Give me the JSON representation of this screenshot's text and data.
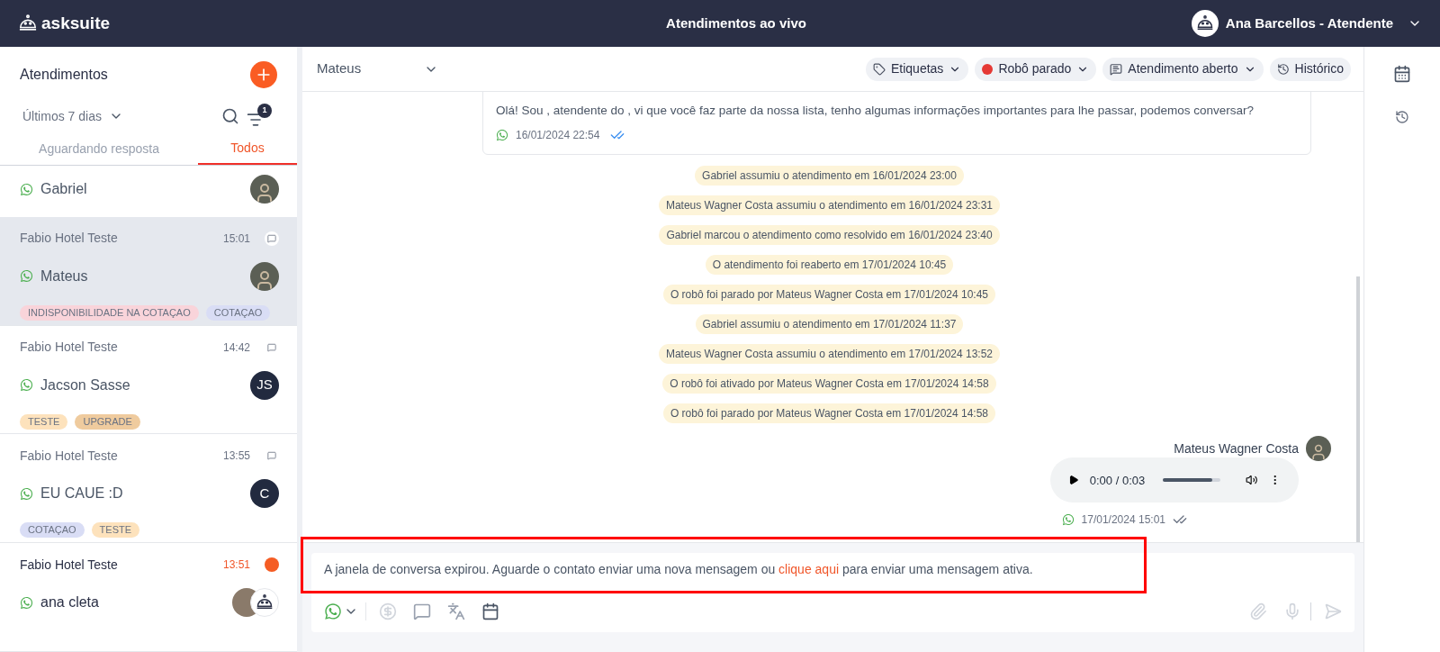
{
  "header": {
    "logo_text": "asksuite",
    "title": "Atendimentos ao vivo",
    "user": "Ana Barcellos - Atendente"
  },
  "sidebar": {
    "title": "Atendimentos",
    "period": "Últimos 7 dias",
    "filter_count": "1",
    "tabs": [
      {
        "label": "Aguardando resposta",
        "selected": false
      },
      {
        "label": "Todos",
        "selected": true
      }
    ],
    "conversations": [
      {
        "name": "Gabriel",
        "kind": "photo",
        "selected": false,
        "unread": false
      },
      {
        "hotel": "Fabio Hotel Teste",
        "time": "15:01",
        "name": "Mateus",
        "kind": "photo",
        "selected": true,
        "unread": false,
        "tags": [
          {
            "label": "INDISPONIBILIDADE NA COTAÇAO",
            "color": "#f9d4da"
          },
          {
            "label": "COTAÇAO",
            "color": "#d9ddf5"
          }
        ]
      },
      {
        "hotel": "Fabio Hotel Teste",
        "time": "14:42",
        "name": "Jacson Sasse",
        "kind": "initials",
        "initials": "JS",
        "selected": false,
        "unread": false,
        "tags": [
          {
            "label": "TESTE",
            "color": "#fde2bc"
          },
          {
            "label": "UPGRADE",
            "color": "#efcb9e"
          }
        ]
      },
      {
        "hotel": "Fabio Hotel Teste",
        "time": "13:55",
        "name": "EU CAUE :D",
        "kind": "initials",
        "initials": "C",
        "selected": false,
        "unread": false,
        "tags": [
          {
            "label": "COTAÇAO",
            "color": "#d9ddf5"
          },
          {
            "label": "TESTE",
            "color": "#fde2bc"
          }
        ]
      },
      {
        "hotel": "Fabio Hotel Teste",
        "time": "13:51",
        "name": "ana cleta",
        "kind": "photo_bot",
        "selected": false,
        "unread": true
      }
    ]
  },
  "chat": {
    "contact": "Mateus",
    "toolbar": [
      {
        "kind": "tag",
        "label": "Etiquetas"
      },
      {
        "kind": "robot",
        "label": "Robô parado"
      },
      {
        "kind": "status",
        "label": "Atendimento aberto"
      },
      {
        "kind": "history",
        "label": "Histórico"
      }
    ],
    "messages": [
      {
        "kind": "bubble",
        "text": "Olá! Sou , atendente do , vi que você faz parte da nossa lista, tenho algumas informações importantes para lhe passar, podemos conversar?",
        "timestamp": "16/01/2024 22:54"
      },
      {
        "kind": "event",
        "text": "Gabriel assumiu o atendimento em 16/01/2024 23:00"
      },
      {
        "kind": "event",
        "text": "Mateus Wagner Costa assumiu o atendimento em 16/01/2024 23:31"
      },
      {
        "kind": "event",
        "text": "Gabriel marcou o atendimento como resolvido em 16/01/2024 23:40"
      },
      {
        "kind": "event",
        "text": "O atendimento foi reaberto em 17/01/2024 10:45"
      },
      {
        "kind": "event",
        "text": "O robô foi parado por Mateus Wagner Costa em 17/01/2024 10:45"
      },
      {
        "kind": "event",
        "text": "Gabriel assumiu o atendimento em 17/01/2024 11:37"
      },
      {
        "kind": "event",
        "text": "Mateus Wagner Costa assumiu o atendimento em 17/01/2024 13:52"
      },
      {
        "kind": "event",
        "text": "O robô foi ativado por Mateus Wagner Costa em 17/01/2024 14:58"
      },
      {
        "kind": "event",
        "text": "O robô foi parado por Mateus Wagner Costa em 17/01/2024 14:58"
      },
      {
        "kind": "audio",
        "sender": "Mateus Wagner Costa",
        "duration": "0:00 / 0:03",
        "level": 0.85,
        "timestamp": "17/01/2024 15:01"
      }
    ],
    "notice": {
      "before": "A janela de conversa expirou. Aguarde o contato enviar uma nova mensagem ou",
      "link": "clique aqui",
      "after": "para enviar uma mensagem ativa."
    }
  }
}
